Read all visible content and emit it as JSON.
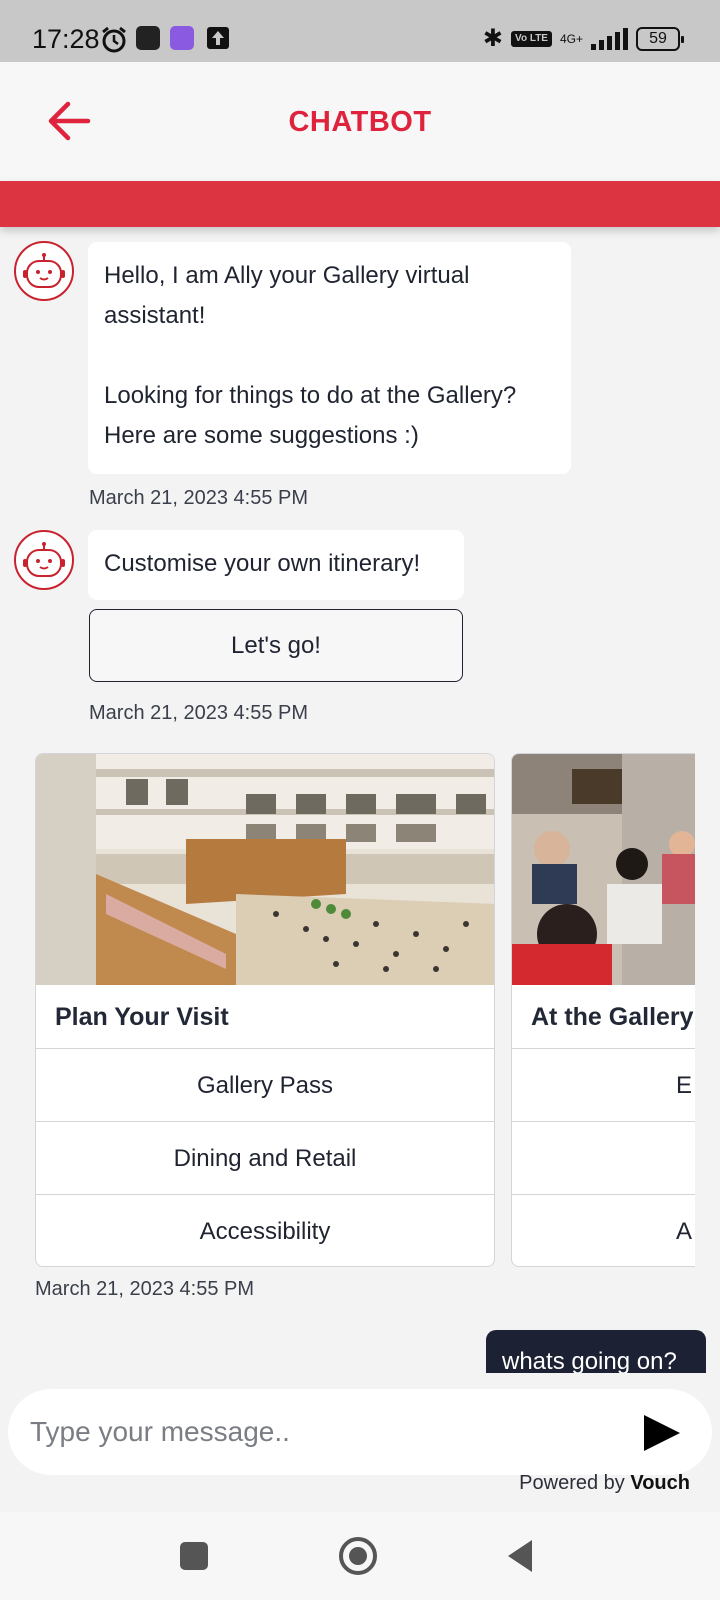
{
  "status_bar": {
    "time": "17:28",
    "network": "4G+",
    "volte": "Vo LTE",
    "battery": "59",
    "icons": [
      "alarm-icon",
      "app-notification-icon",
      "purple-app-icon",
      "upload-icon",
      "bluetooth-icon",
      "signal-icon",
      "battery-icon"
    ]
  },
  "header": {
    "title": "CHATBOT",
    "accent_color": "#e0233d",
    "bar_color": "#dc3440"
  },
  "messages": {
    "greeting": "Hello, I am Ally your Gallery virtual assistant!\n\nLooking for things to do at the Gallery? Here are some suggestions :)",
    "greeting_time": "March 21, 2023 4:55 PM",
    "itinerary": "Customise your own itinerary!",
    "itinerary_button": "Let's go!",
    "itinerary_time": "March 21, 2023 4:55 PM",
    "cards_time": "March 21, 2023 4:55 PM",
    "user_message": "whats going on?"
  },
  "cards": [
    {
      "title": "Plan Your Visit",
      "buttons": [
        "Gallery Pass",
        "Dining and Retail",
        "Accessibility"
      ]
    },
    {
      "title": "At the Gallery",
      "buttons": [
        "E",
        "",
        "A"
      ]
    }
  ],
  "composer": {
    "placeholder": "Type your message..",
    "powered_prefix": "Powered by",
    "powered_brand": "Vouch"
  },
  "nav": {
    "icons": [
      "recents-square-icon",
      "home-circle-icon",
      "back-triangle-icon"
    ]
  }
}
